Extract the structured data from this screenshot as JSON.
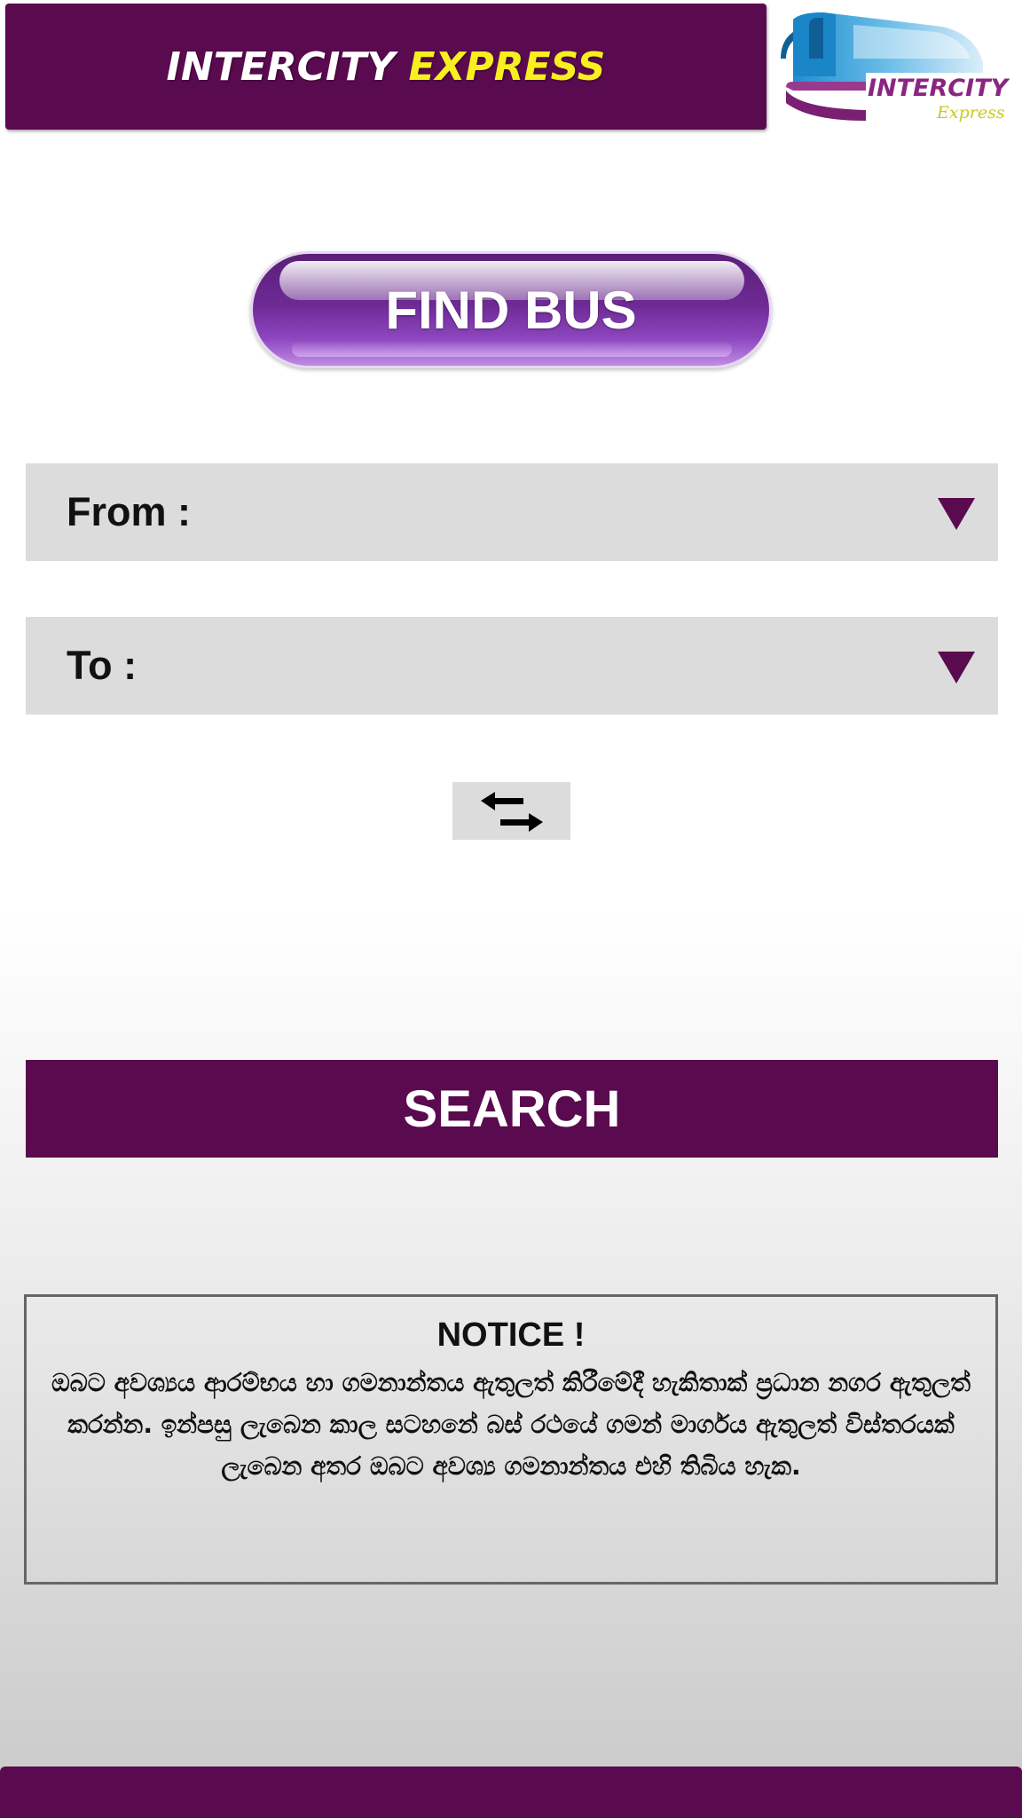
{
  "header": {
    "title_part1": "INTERCITY",
    "title_part2": "EXPRESS",
    "title_part1_color": "#ffffff",
    "title_part2_color": "#f7ef1f",
    "background_color": "#5a0a4f"
  },
  "logo": {
    "text": "INTERCITY",
    "subtext": "Express",
    "icon": "bus-icon"
  },
  "find_bus_button": {
    "label": "FIND BUS"
  },
  "form": {
    "from_label": "From :",
    "to_label": "To :",
    "dropdown_icon": "triangle-down-icon",
    "swap_icon": "swap-arrows-icon"
  },
  "search_button": {
    "label": "SEARCH",
    "background_color": "#5a0a4f"
  },
  "notice": {
    "title": "NOTICE !",
    "body": "ඔබට අවශ්‍යය ආරම්භය හා ගමනාන්තය ඇතුලත් කිරීමේදී හැකිතාක් ප්‍රධාන නගර ඇතුලත් කරන්න. ඉන්පසු ලැබෙන කාල සටහනේ බස් රථයේ ගමන් මාර්ගය ඇතුලත් විස්තරයක් ලැබෙන අතර ඔබට අවශ්‍ය ගමනාන්තය එහි තිබිය හැක."
  },
  "colors": {
    "accent": "#5a0a4f",
    "field_background": "#dcdcdc"
  }
}
